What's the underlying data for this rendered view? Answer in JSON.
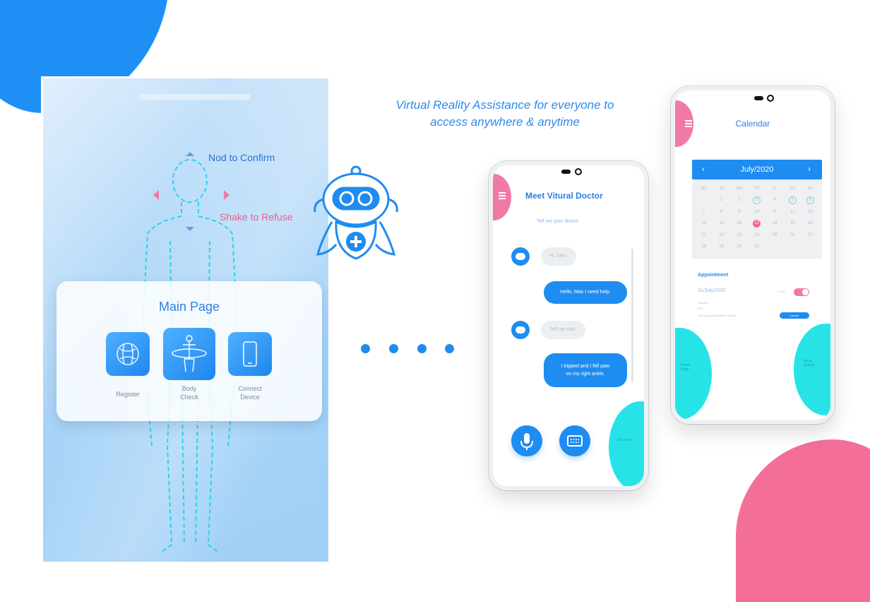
{
  "tagline": {
    "line1": "Virtual Reality Assistance for everyone to",
    "line2": "access anywhere & anytime"
  },
  "vr_panel": {
    "nod_text": "Nod to Confirm",
    "shake_text": "Shake to Refuse",
    "card_title": "Main Page",
    "buttons": [
      {
        "label": "Register",
        "icon": "globe-icon"
      },
      {
        "label": "Body\nCheck",
        "label_line1": "Body",
        "label_line2": "Check",
        "icon": "body-scan-icon"
      },
      {
        "label_line1": "Connect",
        "label_line2": "Device",
        "icon": "phone-icon"
      }
    ]
  },
  "chat_phone": {
    "title": "Meet Vitural Doctor",
    "subtitle": "Tell me your illness",
    "messages": [
      {
        "from": "bot",
        "text": "Hi, Alec."
      },
      {
        "from": "user",
        "text": "Hello, Max I need help."
      },
      {
        "from": "bot",
        "text": "Tell me Alec."
      },
      {
        "from": "user",
        "line1": "I tripped and I fell pain",
        "line2": "on my right ankle."
      }
    ],
    "buttons": [
      {
        "icon": "microphone-icon"
      },
      {
        "icon": "keyboard-icon"
      }
    ],
    "side_label": "Discover"
  },
  "calendar_phone": {
    "title": "Calendar",
    "month": "July/2020",
    "weekdays": [
      "Mo",
      "Tu",
      "We",
      "Th",
      "Fr",
      "Sa",
      "Su"
    ],
    "days": [
      [
        "",
        "1",
        "2",
        "3",
        "4",
        "5",
        "6"
      ],
      [
        "7",
        "8",
        "9",
        "10",
        "11",
        "12",
        "13"
      ],
      [
        "14",
        "15",
        "16",
        "17",
        "18",
        "19",
        "20"
      ],
      [
        "21",
        "22",
        "23",
        "24",
        "25",
        "26",
        "27"
      ],
      [
        "28",
        "29",
        "30",
        "31",
        "",
        "",
        ""
      ]
    ],
    "ringed_days": [
      "3",
      "5",
      "6"
    ],
    "selected_day": "17",
    "appointment": {
      "heading": "Appointment",
      "date": "31/July/2020",
      "time_label": "9:00",
      "details_line1": "Hospital",
      "details_line2": "DAY",
      "details_line3": "Orthopedic Department Doctor",
      "button_label": "Cancel"
    },
    "left_label_line1": "Home",
    "left_label_line2": "Page",
    "right_label_line1": "Go to",
    "right_label_line2": "Activity"
  },
  "colors": {
    "accent_blue": "#1e8cf0",
    "accent_pink": "#f07aa5",
    "accent_cyan": "#27e3e8"
  }
}
